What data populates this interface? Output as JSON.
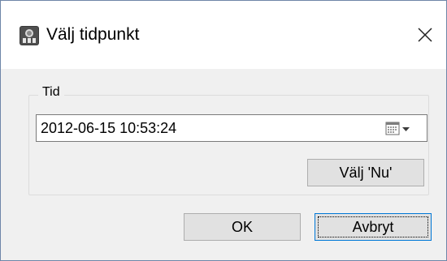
{
  "window": {
    "title": "Välj tidpunkt",
    "app_icon": "app-icon"
  },
  "close": {
    "icon": "close-icon"
  },
  "time_group": {
    "label": "Tid",
    "datetime_value": "2012-06-15 10:53:24",
    "calendar_icon": "calendar-dropdown-icon",
    "now_button_label": "Välj 'Nu'"
  },
  "buttons": {
    "ok_label": "OK",
    "cancel_label": "Avbryt"
  },
  "colors": {
    "window_border": "#6e86a8",
    "focus_border": "#0078d7",
    "dialog_bg": "#f0f0f0"
  }
}
